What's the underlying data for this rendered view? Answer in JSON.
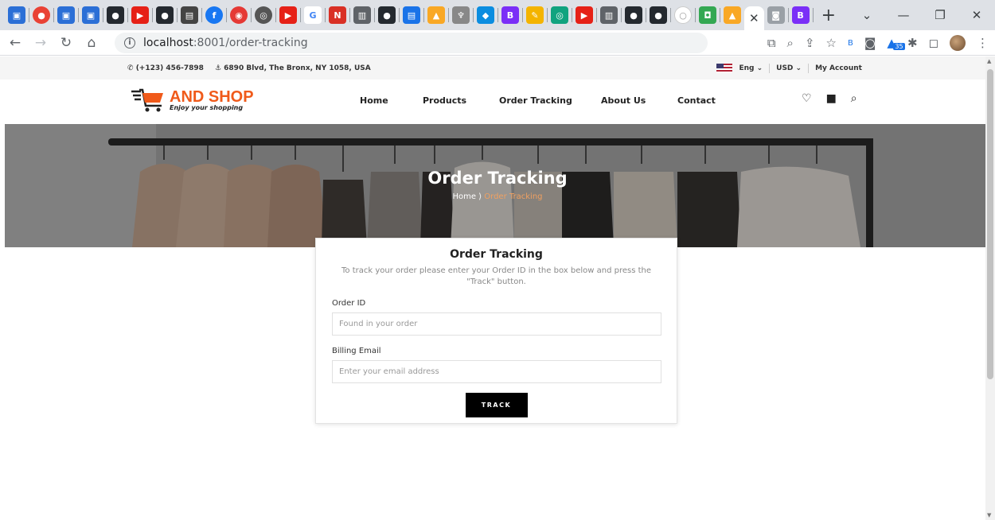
{
  "browser": {
    "url_host": "localhost",
    "url_path": ":8001/order-tracking",
    "new_tab": "+"
  },
  "topbar": {
    "phone": "(+123) 456-7898",
    "address": "6890 Blvd, The Bronx, NY 1058, USA",
    "language": "Eng",
    "currency": "USD",
    "account": "My Account"
  },
  "header": {
    "logo_name": "AND SHOP",
    "logo_tagline": "Enjoy your shopping",
    "nav": [
      "Home",
      "Products",
      "Order Tracking",
      "About Us",
      "Contact"
    ]
  },
  "hero": {
    "title": "Order Tracking",
    "breadcrumb_home": "Home",
    "breadcrumb_current": "Order Tracking"
  },
  "form": {
    "title": "Order Tracking",
    "description": "To track your order please enter your Order ID in the box below and press the \"Track\" button.",
    "order_id_label": "Order ID",
    "order_id_placeholder": "Found in your order",
    "email_label": "Billing Email",
    "email_placeholder": "Enter your email address",
    "submit_label": "TRACK"
  },
  "colors": {
    "brand": "#f05a1a",
    "button": "#000000",
    "breadcrumb_active": "#f0a060"
  }
}
